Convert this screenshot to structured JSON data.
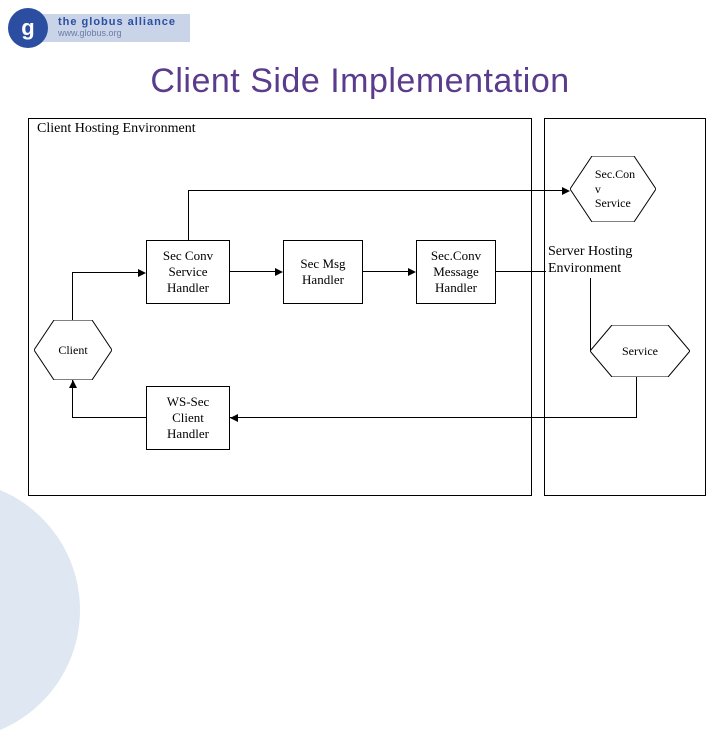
{
  "logo": {
    "glyph": "g",
    "main": "the globus alliance",
    "sub": "www.globus.org"
  },
  "title": "Client Side Implementation",
  "client_env_label": "Client Hosting Environment",
  "server_env_label": "Server Hosting Environment",
  "nodes": {
    "client": "Client",
    "sec_conv_service_handler": "Sec Conv\nService\nHandler",
    "sec_msg_handler": "Sec Msg\nHandler",
    "sec_conv_message_handler": "Sec.Conv\nMessage\nHandler",
    "ws_sec_client_handler": "WS-Sec\nClient\nHandler",
    "sec_conv_service": "Sec.Con\nv\nService",
    "service": "Service"
  }
}
